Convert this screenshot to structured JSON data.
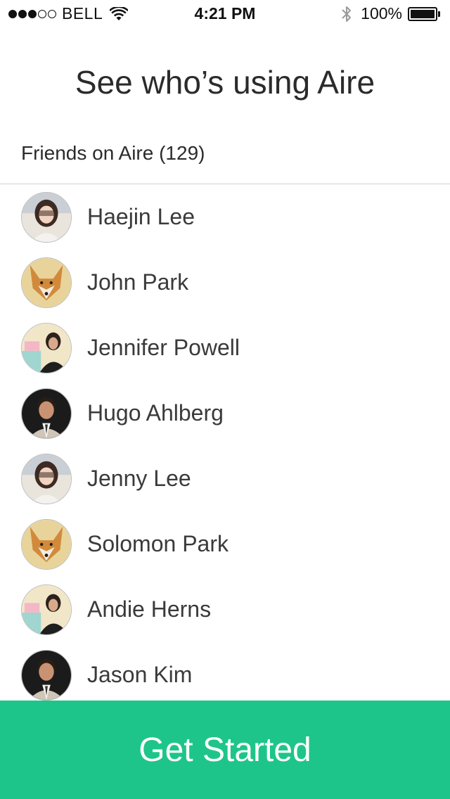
{
  "status_bar": {
    "signal_dots_filled": 3,
    "signal_dots_total": 5,
    "carrier": "BELL",
    "time": "4:21 PM",
    "battery": "100%"
  },
  "title": "See who’s using Aire",
  "section_header": "Friends on Aire (129)",
  "friends": [
    {
      "name": "Haejin Lee",
      "avatar": "woman-light"
    },
    {
      "name": "John Park",
      "avatar": "fox"
    },
    {
      "name": "Jennifer Powell",
      "avatar": "woman-dark"
    },
    {
      "name": "Hugo Ahlberg",
      "avatar": "man-suit"
    },
    {
      "name": "Jenny Lee",
      "avatar": "woman-light"
    },
    {
      "name": "Solomon Park",
      "avatar": "fox"
    },
    {
      "name": "Andie Herns",
      "avatar": "woman-dark"
    },
    {
      "name": "Jason Kim",
      "avatar": "man-suit"
    }
  ],
  "cta": {
    "label": "Get Started",
    "color": "#1ec58a"
  }
}
